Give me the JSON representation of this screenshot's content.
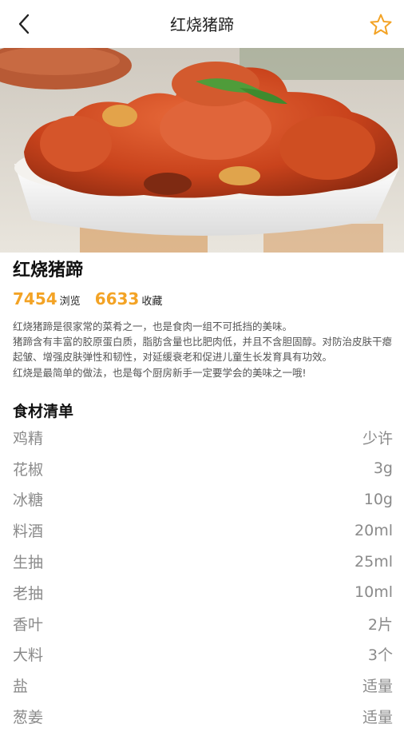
{
  "header": {
    "title": "红烧猪蹄"
  },
  "recipe": {
    "name": "红烧猪蹄",
    "views": "7454",
    "views_label": "浏览",
    "favorites": "6633",
    "favorites_label": "收藏",
    "description": [
      "红烧猪蹄是很家常的菜肴之一，也是食肉一组不可抵挡的美味。",
      "猪蹄含有丰富的胶原蛋白质，脂肪含量也比肥肉低，并且不含胆固醇。对防治皮肤干瘪起皱、增强皮肤弹性和韧性，对延缓衰老和促进儿童生长发育具有功效。",
      "红烧是最简单的做法，也是每个厨房新手一定要学会的美味之一哦!"
    ]
  },
  "ingredients": {
    "title": "食材清单",
    "items": [
      {
        "name": "鸡精",
        "amount": "少许"
      },
      {
        "name": "花椒",
        "amount": "3g"
      },
      {
        "name": "冰糖",
        "amount": "10g"
      },
      {
        "name": "料酒",
        "amount": "20ml"
      },
      {
        "name": "生抽",
        "amount": "25ml"
      },
      {
        "name": "老抽",
        "amount": "10ml"
      },
      {
        "name": "香叶",
        "amount": "2片"
      },
      {
        "name": "大料",
        "amount": "3个"
      },
      {
        "name": "盐",
        "amount": "适量"
      },
      {
        "name": "葱姜",
        "amount": "适量"
      }
    ]
  },
  "colors": {
    "accent": "#f3a325",
    "muted_text": "#8a8a8a"
  },
  "icons": {
    "back": "chevron-left-icon",
    "favorite": "star-outline-icon"
  }
}
